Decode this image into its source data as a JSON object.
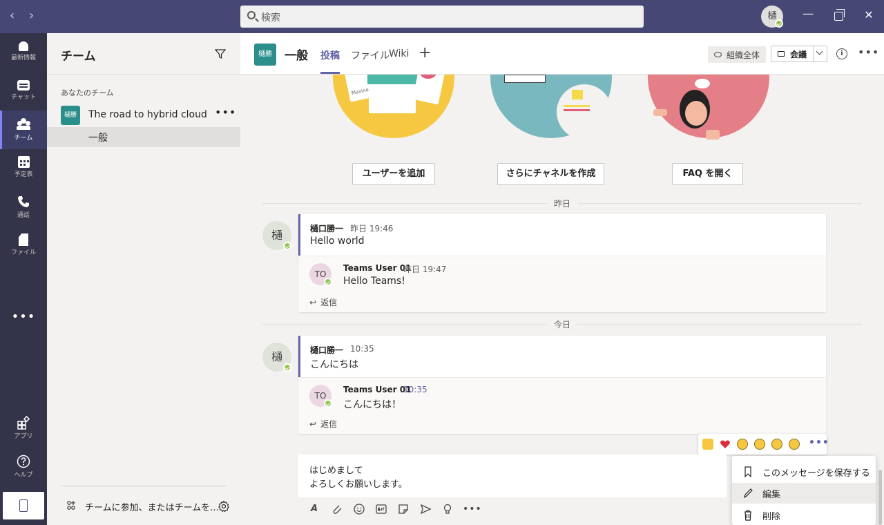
{
  "titlebar": {
    "back": "‹",
    "forward": "›",
    "search_placeholder": "検索",
    "user_initial": "樋",
    "min": "—",
    "close": "✕"
  },
  "rail": {
    "items": [
      {
        "label": "最新情報",
        "icon": "bell-icon"
      },
      {
        "label": "チャット",
        "icon": "chat-icon"
      },
      {
        "label": "チーム",
        "icon": "teams-icon"
      },
      {
        "label": "予定表",
        "icon": "calendar-icon"
      },
      {
        "label": "通話",
        "icon": "phone-icon"
      },
      {
        "label": "ファイル",
        "icon": "file-icon"
      }
    ],
    "more": "•••",
    "apps_label": "アプリ",
    "help_label": "ヘルプ"
  },
  "panel": {
    "title": "チーム",
    "section_label": "あなたのチーム",
    "team_avatar": "樋勝",
    "team_name": "The road to hybrid cloud",
    "team_more": "•••",
    "channel_name": "一般",
    "join_label": "チームに参加、またはチームを..."
  },
  "channel": {
    "avatar": "樋勝",
    "name": "一般",
    "tabs": [
      "投稿",
      "ファイル",
      "Wiki"
    ],
    "add_tab": "+",
    "org_label": "組織全体",
    "meet_label": "会議",
    "info": "i",
    "more": "•••"
  },
  "welcome": {
    "buttons": [
      "ユーザーを追加",
      "さらにチャネルを作成",
      "FAQ を開く"
    ],
    "card_label_1": "Maxine"
  },
  "feed": {
    "day1": "昨日",
    "day2": "今日",
    "threads": [
      {
        "avatar": "樋",
        "author": "樋口勝一",
        "time": "昨日 19:46",
        "body": "Hello world",
        "reply": {
          "avatar": "TO",
          "author": "Teams User 01",
          "time": "昨日 19:47",
          "body": "Hello Teams!"
        },
        "reply_label": "返信"
      },
      {
        "avatar": "樋",
        "author": "樋口勝一",
        "time": "10:35",
        "body": "こんにちは",
        "reply": {
          "avatar": "TO",
          "author": "Teams User 01",
          "time": "10:35",
          "body": "こんにちは！"
        },
        "reply_label": "返信"
      }
    ]
  },
  "reactions": [
    "like",
    "heart",
    "laugh",
    "surprised",
    "sad",
    "angry"
  ],
  "reactions_more": "•••",
  "compose": {
    "line1": "はじめまして",
    "line2": "よろしくお願いします。"
  },
  "context_menu": {
    "items": [
      "このメッセージを保存する",
      "編集",
      "削除"
    ]
  },
  "colors": {
    "brand": "#6264a7",
    "titlebar": "#464775",
    "rail": "#33344a",
    "presence": "#92c353",
    "teal": "#2a8f8a"
  }
}
